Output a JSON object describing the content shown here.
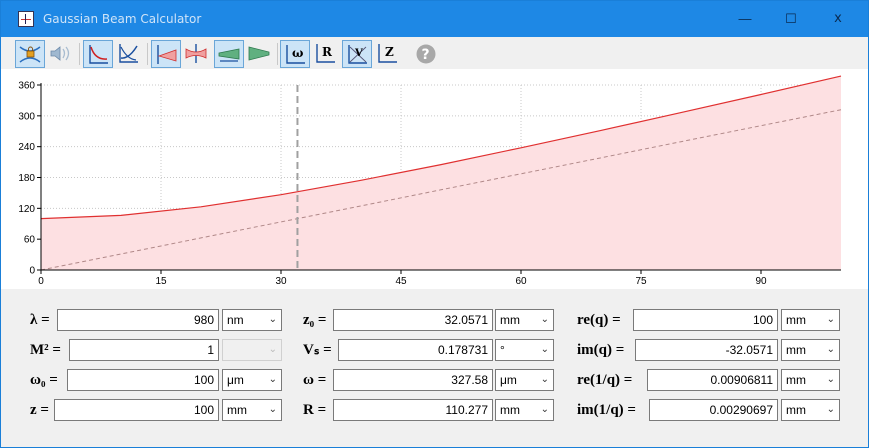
{
  "window": {
    "title": "Gaussian Beam Calculator"
  },
  "title_controls": {
    "minimize": "—",
    "maximize": "☐",
    "close": "x"
  },
  "toolbar": {
    "buttons": [
      {
        "name": "beam-waist-lock-button",
        "icon": "beam-lock-icon",
        "pressed": true
      },
      {
        "name": "beam-audio-button",
        "icon": "beam-speaker-icon",
        "pressed": false
      },
      {
        "name": "plot-curve-a-button",
        "icon": "curve-axes-icon",
        "pressed": true
      },
      {
        "name": "plot-curve-b-button",
        "icon": "curve-axes-alt-icon",
        "pressed": false
      },
      {
        "name": "beam-forward-button",
        "icon": "beam-forward-icon",
        "pressed": true
      },
      {
        "name": "beam-focus-button",
        "icon": "beam-focus-icon",
        "pressed": false
      },
      {
        "name": "beam-expand-button",
        "icon": "beam-expand-icon",
        "pressed": true
      },
      {
        "name": "beam-collapse-button",
        "icon": "beam-collapse-icon",
        "pressed": false
      },
      {
        "name": "plot-omega-button",
        "icon": "omega-plot-icon",
        "pressed": true
      },
      {
        "name": "plot-r-button",
        "icon": "r-plot-icon",
        "pressed": false
      },
      {
        "name": "plot-v-button",
        "icon": "v-plot-icon",
        "pressed": true
      },
      {
        "name": "plot-z-button",
        "icon": "z-plot-icon",
        "pressed": false
      },
      {
        "name": "help-button",
        "icon": "help-icon",
        "pressed": false
      }
    ]
  },
  "colors": {
    "accent": "#1e88e5",
    "beam_line": "#e03030",
    "beam_fill": "#fde0e2",
    "asymptote": "#b08888",
    "z_marker": "#a0a0a0"
  },
  "chart_data": {
    "type": "area",
    "title": "",
    "xlabel": "",
    "ylabel": "",
    "xlim": [
      0,
      100
    ],
    "ylim": [
      0,
      360
    ],
    "x_ticks": [
      0,
      15,
      30,
      45,
      60,
      75,
      90
    ],
    "y_ticks": [
      0,
      60,
      120,
      180,
      240,
      300,
      360
    ],
    "grid": true,
    "legend": "none",
    "z_marker": 32.0571,
    "series": [
      {
        "x": [
          0,
          10,
          20,
          30,
          40,
          50,
          60,
          70,
          80,
          90,
          100
        ],
        "y": [
          100,
          106.2,
          123.0,
          146.6,
          174.5,
          205.2,
          237.7,
          271.6,
          306.3,
          341.6,
          377.4
        ]
      },
      {
        "x": [
          0,
          10,
          20,
          30,
          40,
          50,
          60,
          70,
          80,
          90,
          100
        ],
        "y": [
          0,
          31.2,
          62.4,
          93.6,
          124.8,
          156.0,
          187.2,
          218.4,
          249.6,
          280.8,
          312.0
        ]
      }
    ]
  },
  "fields": {
    "lambda": {
      "label": "λ =",
      "value": "980",
      "unit": "nm"
    },
    "m2": {
      "label": "M² =",
      "value": "1",
      "unit": ""
    },
    "omega0": {
      "label": "ω₀ =",
      "value": "100",
      "unit": "μm"
    },
    "z": {
      "label": "z =",
      "value": "100",
      "unit": "mm"
    },
    "z0": {
      "label": "z₀ =",
      "value": "32.0571",
      "unit": "mm"
    },
    "vs": {
      "label": "Vₛ =",
      "value": "0.178731",
      "unit": "°"
    },
    "omega": {
      "label": "ω =",
      "value": "327.58",
      "unit": "μm"
    },
    "r": {
      "label": "R =",
      "value": "110.277",
      "unit": "mm"
    },
    "req": {
      "label": "re(q) =",
      "value": "100",
      "unit": "mm"
    },
    "imq": {
      "label": "im(q) =",
      "value": "-32.0571",
      "unit": "mm"
    },
    "re1q": {
      "label": "re(1/q) =",
      "value": "0.00906811",
      "unit": "mm"
    },
    "im1q": {
      "label": "im(1/q) =",
      "value": "0.00290697",
      "unit": "mm"
    }
  }
}
